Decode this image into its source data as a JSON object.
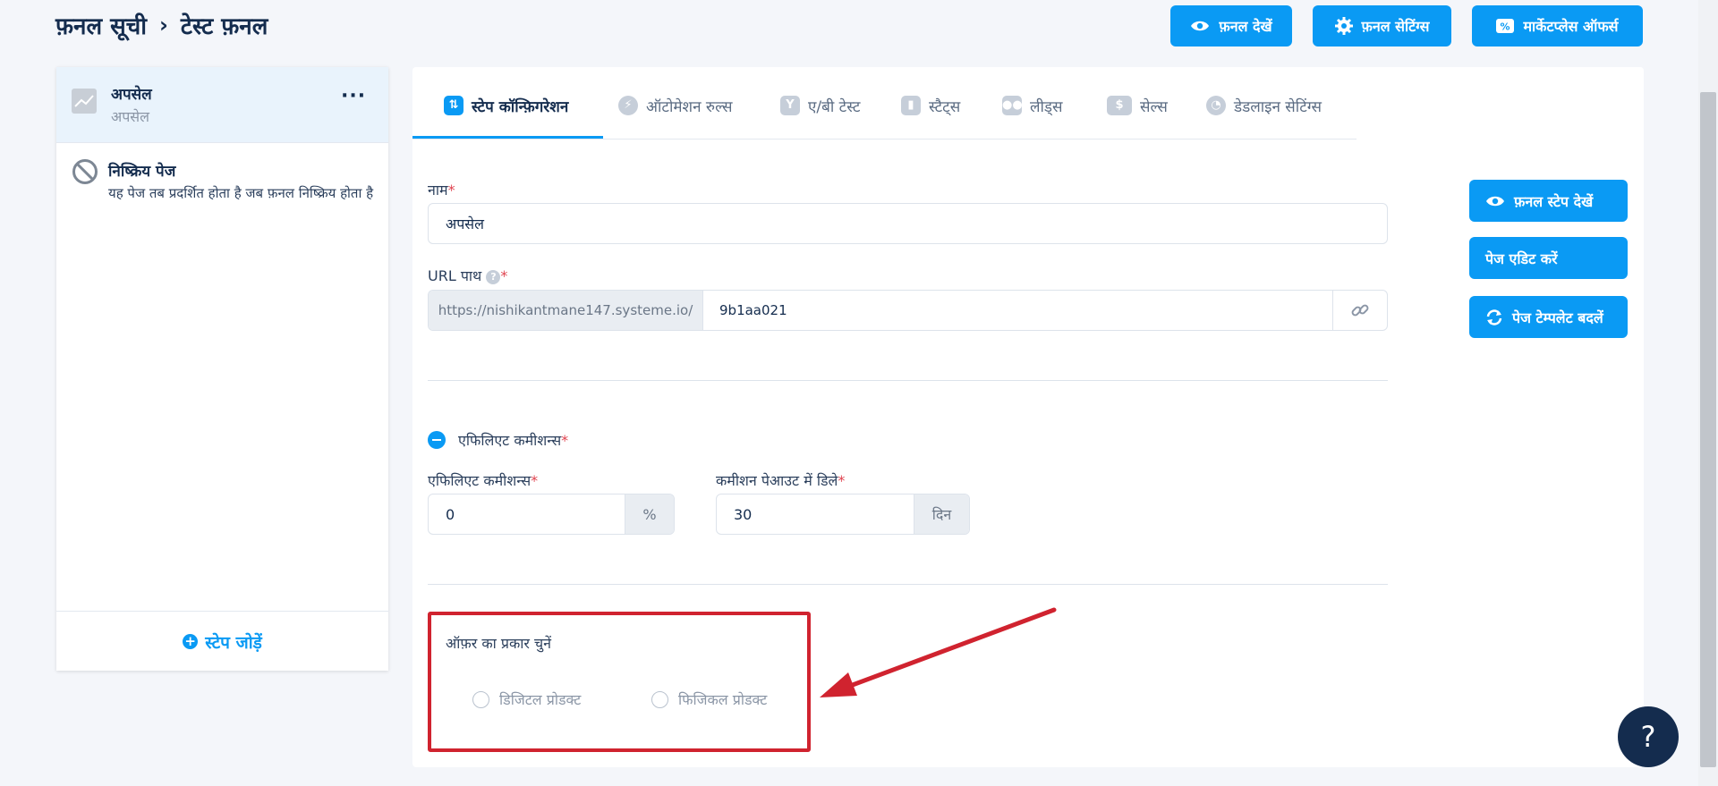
{
  "breadcrumb": {
    "parent": "फ़नल सूची",
    "separator": "›",
    "current": "टेस्ट फ़नल"
  },
  "header_buttons": {
    "view_funnel": "फ़नल देखें",
    "funnel_settings": "फ़नल सेटिंग्स",
    "marketplace_offers": "मार्केटप्लेस ऑफर्स"
  },
  "sidebar": {
    "step": {
      "title": "अपसेल",
      "subtitle": "अपसेल",
      "more": "···"
    },
    "inactive_page": {
      "title": "निष्क्रिय पेज",
      "description": "यह पेज तब प्रदर्शित होता है जब फ़नल निष्क्रिय होता है"
    },
    "add_step": "स्टेप जोड़ें"
  },
  "tabs": [
    {
      "label": "स्टेप कॉन्फ़िगरेशन",
      "icon": "sliders-icon",
      "active": true
    },
    {
      "label": "ऑटोमेशन रुल्स",
      "icon": "bolt-icon",
      "active": false
    },
    {
      "label": "ए/बी टेस्ट",
      "icon": "split-icon",
      "active": false
    },
    {
      "label": "स्टैट्स",
      "icon": "bar-chart-icon",
      "active": false
    },
    {
      "label": "लीड्स",
      "icon": "users-icon",
      "active": false
    },
    {
      "label": "सेल्स",
      "icon": "dollar-icon",
      "active": false
    },
    {
      "label": "डेडलाइन सेटिंग्स",
      "icon": "clock-icon",
      "active": false
    }
  ],
  "form": {
    "name_label": "नाम",
    "name_value": "अपसेल",
    "url_label": "URL पाथ",
    "url_prefix": "https://nishikantmane147.systeme.io/",
    "url_value": "9b1aa021",
    "affiliate_section_label": "एफिलिएट कमीशन्स",
    "affiliate_field_label": "एफिलिएट कमीशन्स",
    "affiliate_value": "0",
    "affiliate_unit": "%",
    "delay_label": "कमीशन पेआउट में डिले",
    "delay_value": "30",
    "delay_unit": "दिन",
    "offer_type_label": "ऑफ़र का प्रकार चुनें",
    "offer_options": [
      "डिजिटल प्रोडक्ट",
      "फिजिकल प्रोडक्ट"
    ]
  },
  "side_actions": {
    "view_step": "फ़नल स्टेप देखें",
    "edit_page": "पेज एडिट करें",
    "change_template": "पेज टेम्पलेट बदलें"
  },
  "help_button": "?",
  "colors": {
    "accent": "#0a9af4",
    "heading": "#142c4e",
    "annotation": "#d0232f",
    "required": "#e0434f"
  }
}
